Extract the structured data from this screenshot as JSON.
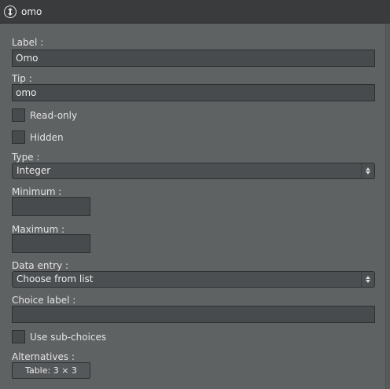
{
  "window": {
    "title": "omo",
    "icon": "up-down-arrow-circle-icon"
  },
  "form": {
    "label": {
      "caption": "Label :",
      "value": "Omo"
    },
    "tip": {
      "caption": "Tip :",
      "value": "omo"
    },
    "read_only": {
      "caption": "Read-only",
      "checked": false
    },
    "hidden": {
      "caption": "Hidden",
      "checked": false
    },
    "type": {
      "caption": "Type :",
      "selected": "Integer"
    },
    "minimum": {
      "caption": "Minimum :",
      "value": ""
    },
    "maximum": {
      "caption": "Maximum :",
      "value": ""
    },
    "data_entry": {
      "caption": "Data entry :",
      "selected": "Choose from list"
    },
    "choice_label": {
      "caption": "Choice label :",
      "value": ""
    },
    "use_sub_choices": {
      "caption": "Use sub-choices",
      "checked": false
    },
    "alternatives": {
      "caption": "Alternatives :",
      "button_label": "Table: 3 × 3"
    }
  },
  "colors": {
    "panel_bg": "#5f6263",
    "titlebar_bg": "#393b3d",
    "field_bg": "#484b4d"
  }
}
